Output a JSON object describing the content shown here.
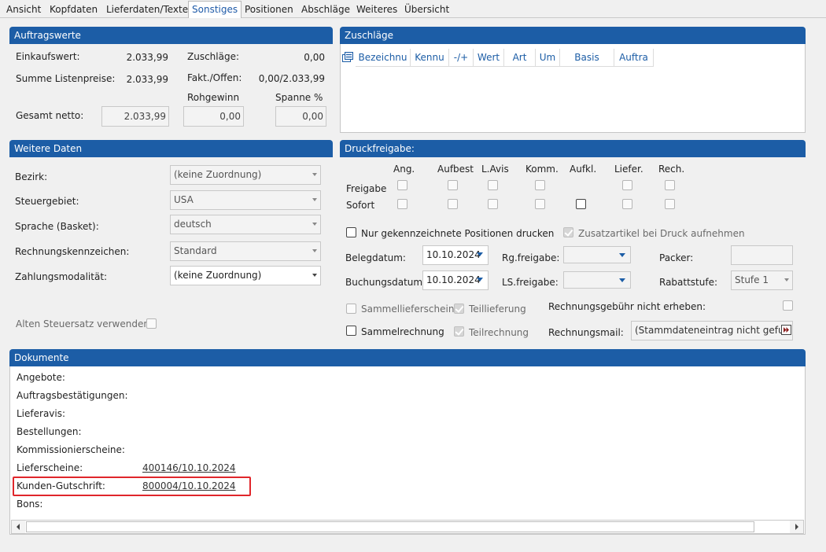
{
  "tabs": [
    "Ansicht",
    "Kopfdaten",
    "Lieferdaten/Texte",
    "Sonstiges",
    "Positionen",
    "Abschläge",
    "Weiteres",
    "Übersicht"
  ],
  "auftragswerte": {
    "title": "Auftragswerte",
    "einkaufswert_label": "Einkaufswert:",
    "einkaufswert": "2.033,99",
    "summe_label": "Summe Listenpreise:",
    "summe": "2.033,99",
    "zuschlaege_label": "Zuschläge:",
    "zuschlaege": "0,00",
    "fakt_label": "Fakt./Offen:",
    "fakt": "0,00/2.033,99",
    "rohgewinn_label": "Rohgewinn",
    "spanne_label": "Spanne %",
    "gesamt_label": "Gesamt netto:",
    "gesamt": "2.033,99",
    "rohgewinn": "0,00",
    "spanne": "0,00"
  },
  "zuschlaege_panel": {
    "title": "Zuschläge",
    "columns": [
      "Bezeichnu",
      "Kennu",
      "-/+",
      "Wert",
      "Art",
      "Um",
      "Basis",
      "Auftra"
    ]
  },
  "weitere": {
    "title": "Weitere Daten",
    "bezirk_label": "Bezirk:",
    "bezirk": "(keine Zuordnung)",
    "steuer_label": "Steuergebiet:",
    "steuer": "USA",
    "sprache_label": "Sprache (Basket):",
    "sprache": "deutsch",
    "rk_label": "Rechnungskennzeichen:",
    "rk": "Standard",
    "zahlung_label": "Zahlungsmodalität:",
    "zahlung": "(keine Zuordnung)",
    "alten_label": "Alten Steuersatz verwenden"
  },
  "druck": {
    "title": "Druckfreigabe:",
    "cols": [
      "Ang.",
      "Aufbest",
      "L.Avis",
      "Komm.",
      "Aufkl.",
      "Liefer.",
      "Rech."
    ],
    "row_freigabe": "Freigabe",
    "row_sofort": "Sofort",
    "nur_label": "Nur gekennzeichnete Positionen drucken",
    "zusatz_label": "Zusatzartikel bei Druck aufnehmen",
    "belegdatum_label": "Belegdatum:",
    "belegdatum": "10.10.2024",
    "buchungsdatum_label": "Buchungsdatum:",
    "buchungsdatum": "10.10.2024",
    "rg_label": "Rg.freigabe:",
    "ls_label": "LS.freigabe:",
    "packer_label": "Packer:",
    "rabatt_label": "Rabattstufe:",
    "rabatt": "Stufe 1",
    "sammellieferschein": "Sammellieferschein",
    "teillieferung": "Teillieferung",
    "sammelrechnung": "Sammelrechnung",
    "teilrechnung": "Teilrechnung",
    "gebuehr_label": "Rechnungsgebühr nicht erheben:",
    "mail_label": "Rechnungsmail:",
    "mail": "(Stammdateneintrag nicht gefu"
  },
  "dokumente": {
    "title": "Dokumente",
    "rows": [
      {
        "label": "Angebote:",
        "value": ""
      },
      {
        "label": "Auftragsbestätigungen:",
        "value": ""
      },
      {
        "label": "Lieferavis:",
        "value": ""
      },
      {
        "label": "Bestellungen:",
        "value": ""
      },
      {
        "label": "Kommissionierscheine:",
        "value": ""
      },
      {
        "label": "Lieferscheine:",
        "value": "400146/10.10.2024"
      },
      {
        "label": "Kunden-Gutschrift:",
        "value": "800004/10.10.2024"
      },
      {
        "label": "Bons:",
        "value": ""
      }
    ]
  },
  "colors": {
    "accent": "#1c5da6",
    "highlight": "#e0262b"
  }
}
